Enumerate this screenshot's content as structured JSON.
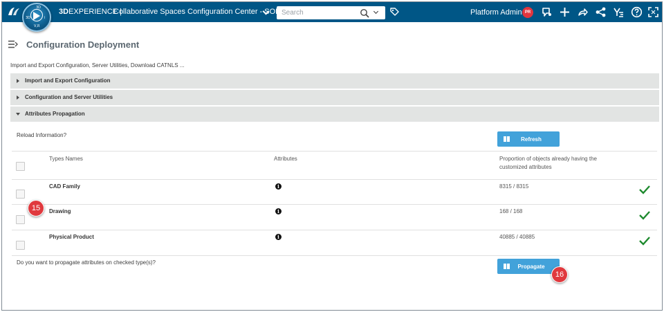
{
  "topbar": {
    "brand_bold": "3D",
    "brand_rest": "EXPERIENCE |",
    "app_title": "Collaborative Spaces Configuration Center - SOL...",
    "search_placeholder": "Search",
    "user_name": "Platform Admin",
    "avatar_initials": "PR",
    "compass_labels": {
      "top": "3D",
      "left": "3D",
      "right": "i",
      "bottom": "V,R"
    },
    "icons": [
      "feedback-icon",
      "add-icon",
      "share-icon",
      "social-share-icon",
      "apps-compass-icon",
      "help-icon",
      "fullscreen-icon"
    ],
    "bar_color": "#005686"
  },
  "page": {
    "title": "Configuration Deployment",
    "subtitle": "Import and Export Configuration, Server Utilities, Download CATNLS ..."
  },
  "accordion": [
    {
      "label": "Import and Export Configuration",
      "expanded": false
    },
    {
      "label": "Configuration and Server Utilities",
      "expanded": false
    },
    {
      "label": "Attributes Propagation",
      "expanded": true
    }
  ],
  "propagation": {
    "reload_question": "Reload Information?",
    "refresh_label": "Refresh",
    "columns": {
      "types": "Types Names",
      "attributes": "Attributes",
      "proportion_line1": "Proportion of objects already having the",
      "proportion_line2": "customized attributes"
    },
    "rows": [
      {
        "name": "CAD Family",
        "proportion": "8315 / 8315",
        "complete": true
      },
      {
        "name": "Drawing",
        "proportion": "168 / 168",
        "complete": true
      },
      {
        "name": "Physical Product",
        "proportion": "40885 / 40885",
        "complete": true
      }
    ],
    "propagate_question": "Do you want to propagate attributes on checked type(s)?",
    "propagate_label": "Propagate",
    "button_color": "#42a2da",
    "check_color": "#1e8a2e"
  },
  "callouts": {
    "first": "15",
    "second": "16",
    "color": "#e0393e"
  }
}
